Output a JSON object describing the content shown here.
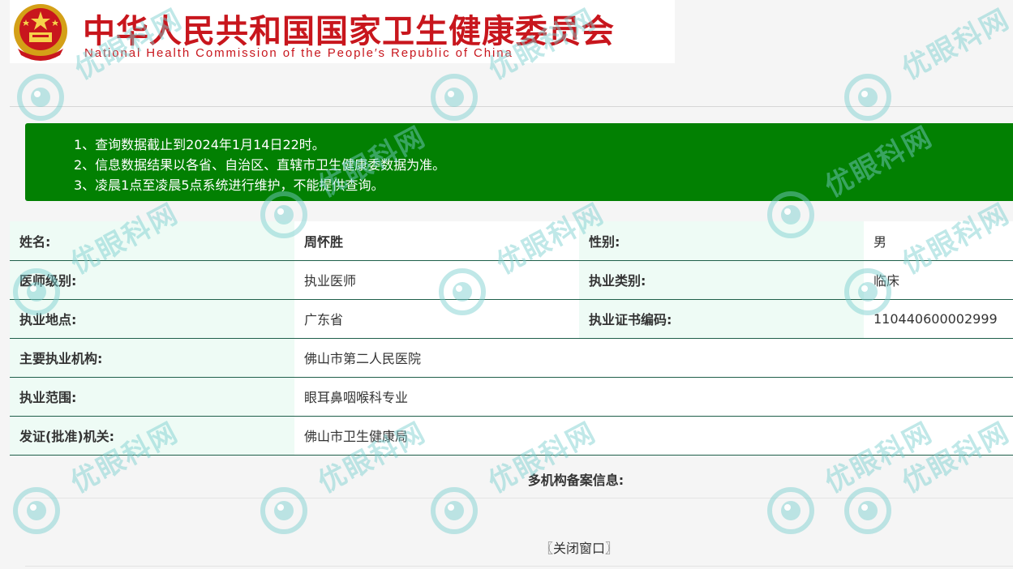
{
  "header": {
    "title_cn": "中华人民共和国国家卫生健康委员会",
    "title_en": "National Health Commission of the People′s Republic of China",
    "emblem_icon": "national-emblem-icon"
  },
  "notice": {
    "lines": [
      "1、查询数据截止到2024年1月14日22时。",
      "2、信息数据结果以各省、自治区、直辖市卫生健康委数据为准。",
      "3、凌晨1点至凌晨5点系统进行维护，不能提供查询。"
    ],
    "background_color": "#028002"
  },
  "info": {
    "name_label": "姓名:",
    "name_value": "周怀胜",
    "gender_label": "性别:",
    "gender_value": "男",
    "level_label": "医师级别:",
    "level_value": "执业医师",
    "category_label": "执业类别:",
    "category_value": "临床",
    "location_label": "执业地点:",
    "location_value": "广东省",
    "cert_label": "执业证书编码:",
    "cert_value": "110440600002999",
    "institution_label": "主要执业机构:",
    "institution_value": "佛山市第二人民医院",
    "scope_label": "执业范围:",
    "scope_value": "眼耳鼻咽喉科专业",
    "authority_label": "发证(批准)机关:",
    "authority_value": "佛山市卫生健康局"
  },
  "multi_institution": {
    "title": "多机构备案信息:"
  },
  "close_button": {
    "label": "〖关闭窗口〗"
  },
  "watermark": {
    "text": "优眼科网",
    "icon": "eye-logo-icon",
    "color": "#78cdcd"
  }
}
